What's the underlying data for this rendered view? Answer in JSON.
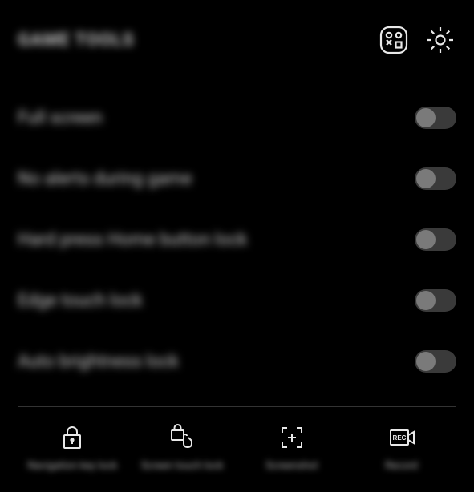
{
  "header": {
    "title": "GAME TOOLS"
  },
  "icons": {
    "games": "games-icon",
    "settings": "settings-icon"
  },
  "toggles": [
    {
      "label": "Full screen",
      "on": false
    },
    {
      "label": "No alerts during game",
      "on": false
    },
    {
      "label": "Hard press Home button lock",
      "on": false
    },
    {
      "label": "Edge touch lock",
      "on": false
    },
    {
      "label": "Auto brightness lock",
      "on": false
    }
  ],
  "actions": [
    {
      "label": "Navigation key lock",
      "icon": "lock-icon"
    },
    {
      "label": "Screen touch lock",
      "icon": "touch-lock-icon"
    },
    {
      "label": "Screenshot",
      "icon": "screenshot-icon"
    },
    {
      "label": "Record",
      "icon": "record-icon"
    }
  ]
}
